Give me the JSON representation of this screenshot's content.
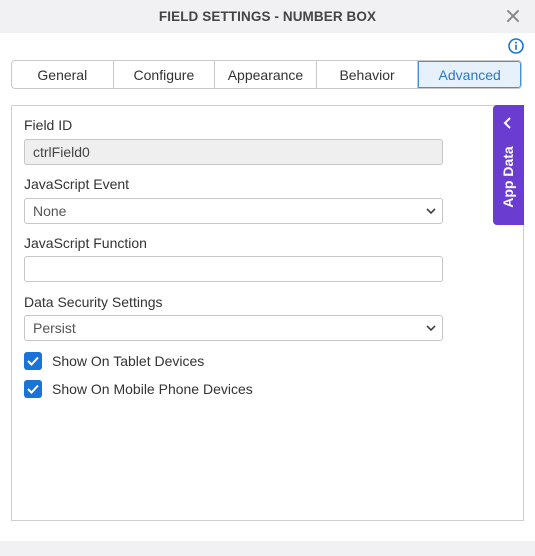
{
  "dialog": {
    "title": "FIELD SETTINGS - NUMBER BOX"
  },
  "tabs": [
    {
      "label": "General"
    },
    {
      "label": "Configure"
    },
    {
      "label": "Appearance"
    },
    {
      "label": "Behavior"
    },
    {
      "label": "Advanced",
      "active": true
    }
  ],
  "form": {
    "field_id": {
      "label": "Field ID",
      "value": "ctrlField0"
    },
    "js_event": {
      "label": "JavaScript Event",
      "value": "None"
    },
    "js_function": {
      "label": "JavaScript Function",
      "value": ""
    },
    "data_security": {
      "label": "Data Security Settings",
      "value": "Persist"
    },
    "show_tablet": {
      "label": "Show On Tablet Devices",
      "checked": true
    },
    "show_mobile": {
      "label": "Show On Mobile Phone Devices",
      "checked": true
    }
  },
  "side_panel": {
    "label": "App Data"
  },
  "colors": {
    "accent": "#1a73d9",
    "app_data_bg": "#6a3ccf",
    "active_tab_text": "#2b77c2"
  },
  "icons": [
    "close-icon",
    "info-icon",
    "chevron-down-icon",
    "chevron-left-icon",
    "checkmark-icon"
  ]
}
